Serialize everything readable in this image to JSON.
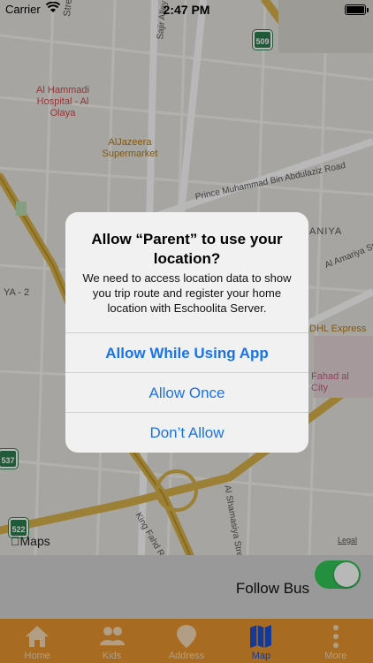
{
  "status_bar": {
    "carrier": "Carrier",
    "time": "2:47 PM"
  },
  "map": {
    "labels": {
      "street_top": "Street",
      "sajir_alley": "Sajir Alley",
      "hospital": "Al Hammadi Hospital - Al Olaya",
      "supermarket": "AlJazeera Supermarket",
      "prince_rd": "Prince Muhammad Bin Abdulaziz Road",
      "aniya": "ANIYA",
      "ya2": "YA - 2",
      "amariya": "Al Amariya Stree",
      "dhl": "DHL Express",
      "fahad_city": "Fahad al City",
      "shamasiya": "Al Shamasiya Street",
      "king_fahd": "King Fahd Rd"
    },
    "route_shields": {
      "r509": "509",
      "r537": "537",
      "r522": "522"
    },
    "brand": "Maps",
    "legal": "Legal"
  },
  "alert": {
    "title": "Allow “Parent” to use your location?",
    "message": "We need to access location data to show you trip route and register your home location with Eschoolita Server.",
    "buttons": [
      "Allow While Using App",
      "Allow Once",
      "Don’t Allow"
    ]
  },
  "follow_bar": {
    "label": "Follow Bus",
    "toggle_on": true
  },
  "tabs": [
    {
      "label": "Home",
      "icon": "home-icon"
    },
    {
      "label": "Kids",
      "icon": "people-icon"
    },
    {
      "label": "Address",
      "icon": "map-pin-icon"
    },
    {
      "label": "Map",
      "icon": "map-icon",
      "active": true
    },
    {
      "label": "More",
      "icon": "more-icon"
    }
  ],
  "colors": {
    "tab_bar": "#e8962f",
    "active_tab": "#1e4fd0",
    "toggle": "#34c759",
    "alert_button": "#1a73e8"
  }
}
